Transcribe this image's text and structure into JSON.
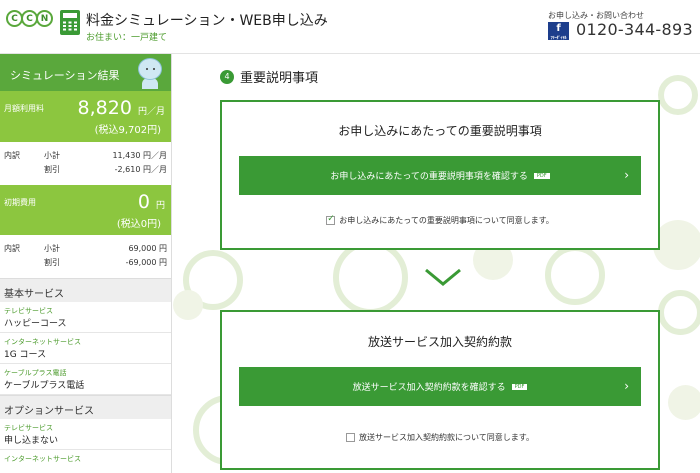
{
  "header": {
    "logo_letters": [
      "C",
      "C",
      "N"
    ],
    "title": "料金シミュレーション・WEB申し込み",
    "subtitle": "お住まい：一戸建て",
    "contact_label": "お申し込み・お問い合わせ",
    "phone": "0120-344-893",
    "freedial_icon": "freedial-icon",
    "freedial_text": "ﾌﾘｰﾀﾞｲﾔﾙ"
  },
  "sidebar": {
    "title": "シミュレーション結果",
    "monthly": {
      "label": "月額利用料",
      "amount": "8,820",
      "unit": "円／月",
      "tax": "(税込9,702円)",
      "breakdown_label": "内訳",
      "rows": [
        {
          "name": "小計",
          "value": "11,430 円／月"
        },
        {
          "name": "割引",
          "value": "-2,610 円／月"
        }
      ]
    },
    "initial": {
      "label": "初期費用",
      "amount": "0",
      "unit": "円",
      "tax": "(税込0円)",
      "breakdown_label": "内訳",
      "rows": [
        {
          "name": "小計",
          "value": "69,000 円"
        },
        {
          "name": "割引",
          "value": "-69,000 円"
        }
      ]
    },
    "basic_section": "基本サービス",
    "basic_items": [
      {
        "category": "テレビサービス",
        "value": "ハッピーコース"
      },
      {
        "category": "インターネットサービス",
        "value": "1G コース"
      },
      {
        "category": "ケーブルプラス電話",
        "value": "ケーブルプラス電話"
      }
    ],
    "option_section": "オプションサービス",
    "option_items": [
      {
        "category": "テレビサービス",
        "value": "申し込まない"
      },
      {
        "category": "インターネットサービス",
        "value": ""
      }
    ]
  },
  "main": {
    "step_number": "4",
    "step_title": "重要説明事項",
    "card1": {
      "title": "お申し込みにあたっての重要説明事項",
      "button": "お申し込みにあたっての重要説明事項を確認する",
      "pdf": "PDF",
      "agree": "お申し込みにあたっての重要説明事項について同意します。",
      "checked": true
    },
    "card2": {
      "title": "放送サービス加入契約約款",
      "button": "放送サービス加入契約約款を確認する",
      "pdf": "PDF",
      "agree": "放送サービス加入契約約款について同意します。",
      "checked": false
    }
  },
  "colors": {
    "accent": "#3a9a35",
    "light_green": "#8cc63f",
    "brand_blue": "#1d3e8c"
  }
}
